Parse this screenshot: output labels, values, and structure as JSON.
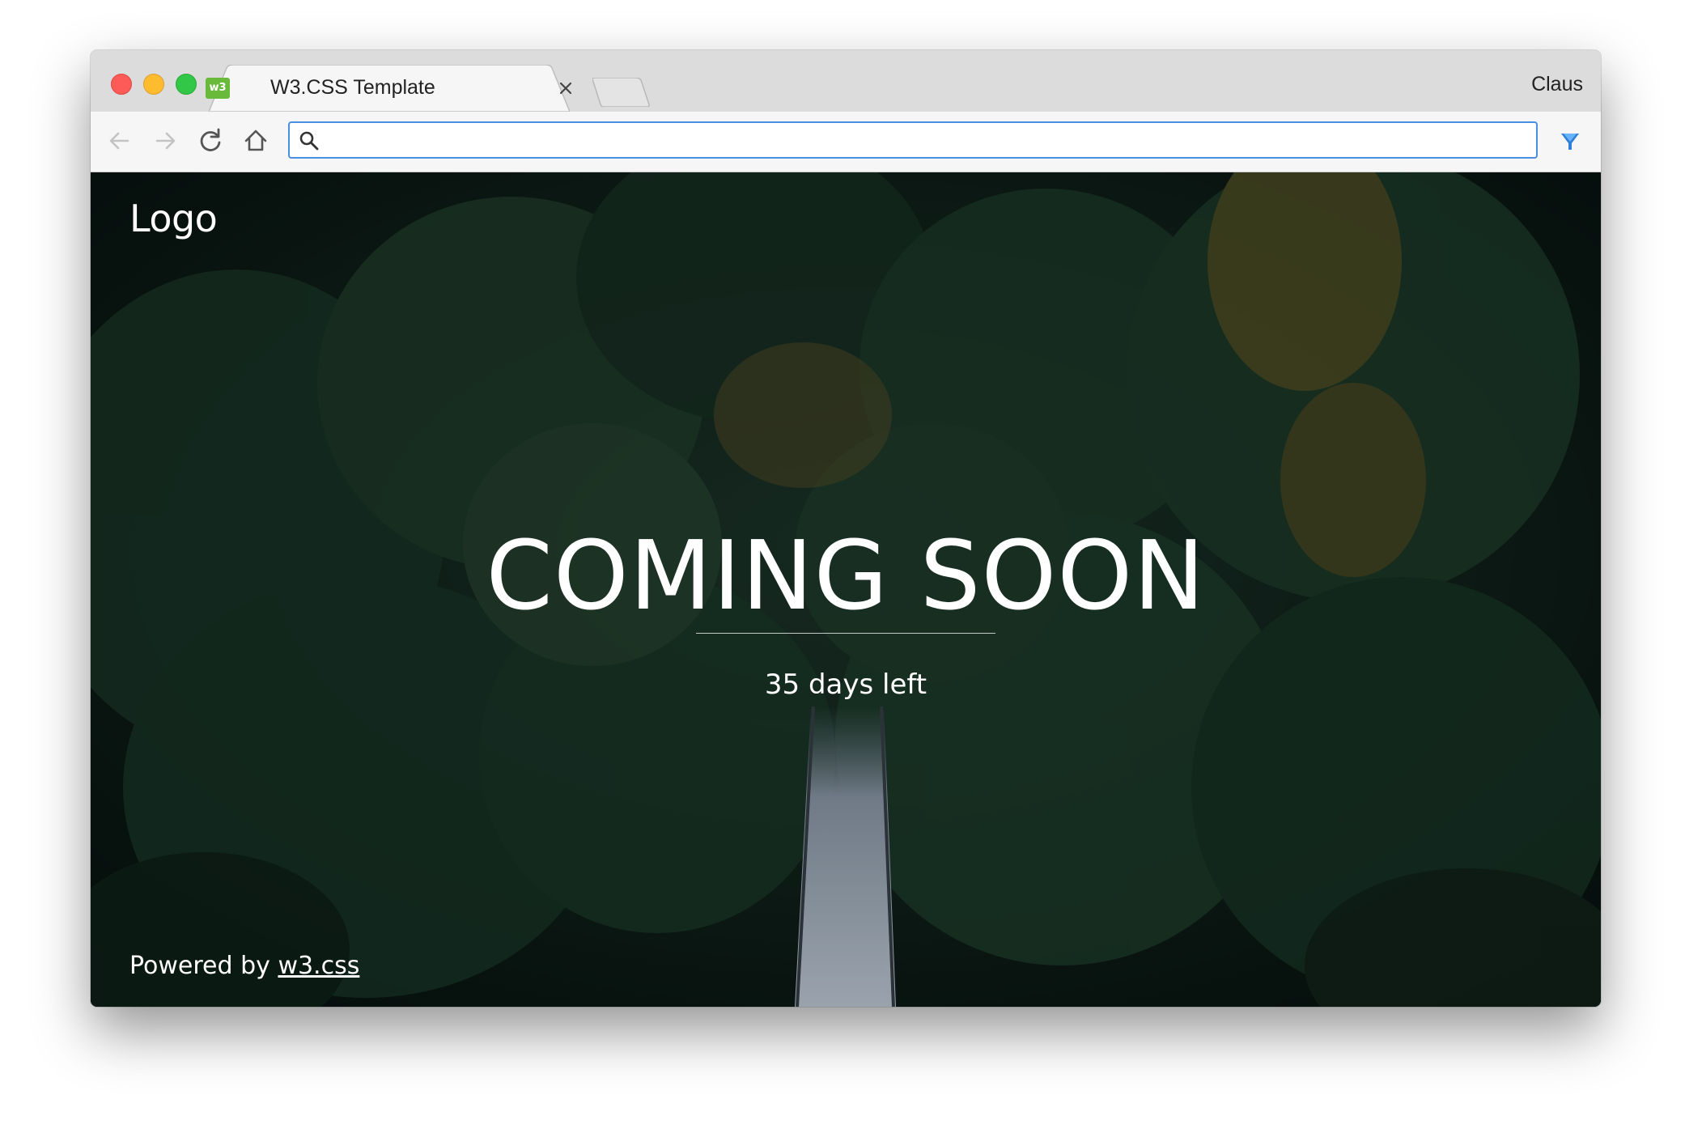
{
  "browser": {
    "tab_title": "W3.CSS Template",
    "favicon_text": "w3",
    "profile_name": "Claus",
    "address_value": "",
    "accent_color": "#4a90e2"
  },
  "page": {
    "logo": "Logo",
    "headline": "COMING SOON",
    "countdown": "35 days left",
    "footer_prefix": "Powered by",
    "footer_link": "w3.css"
  },
  "icons": {
    "back": "arrow-left-icon",
    "forward": "arrow-right-icon",
    "reload": "reload-icon",
    "home": "home-icon",
    "search": "search-icon",
    "extension_1": "funnel-extension-icon",
    "extension_2": "lifebuoy-extension-icon",
    "menu": "kebab-menu-icon"
  }
}
